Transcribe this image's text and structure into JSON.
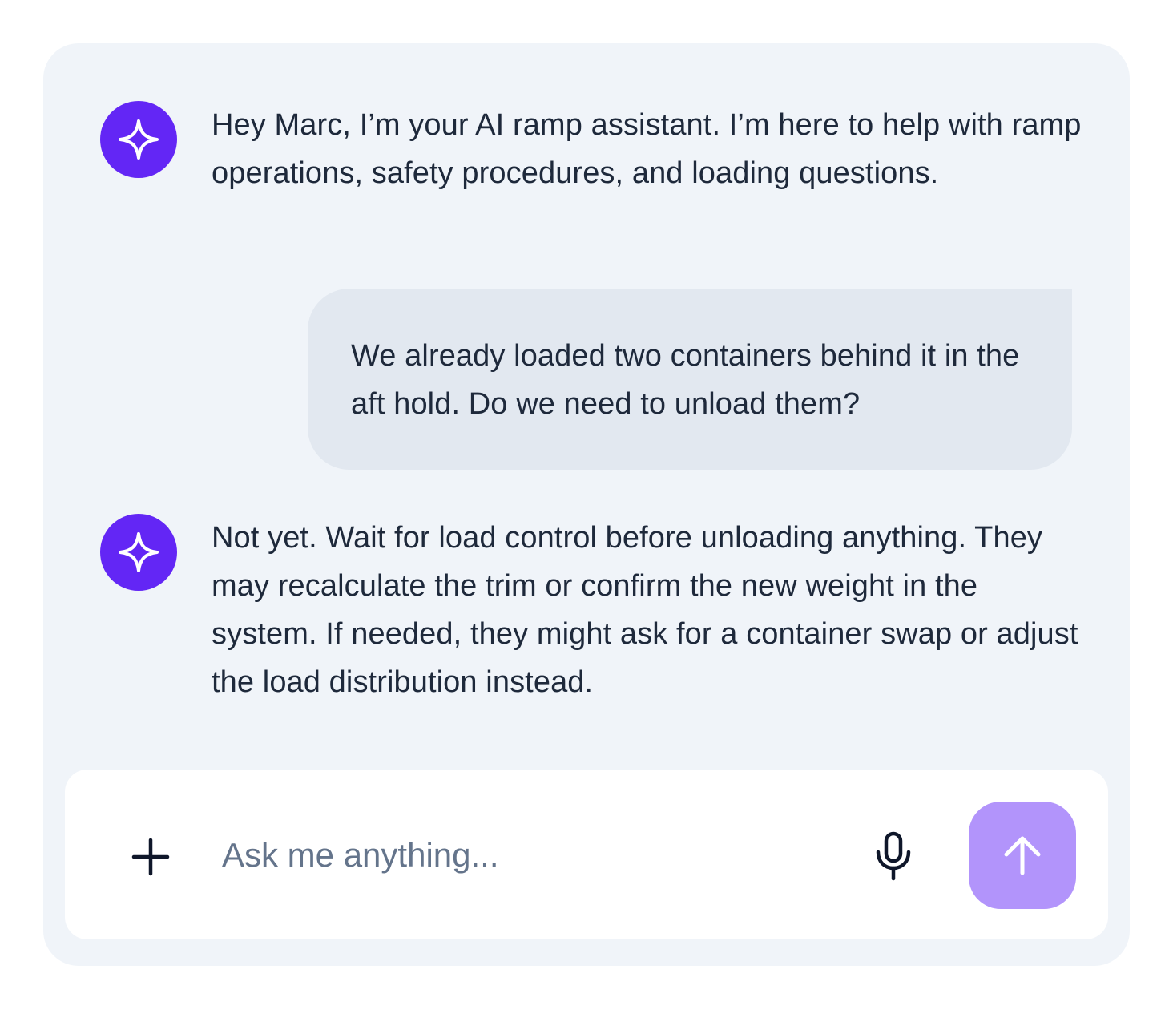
{
  "chat": {
    "messages": [
      {
        "role": "assistant",
        "icon": "sparkle-icon",
        "text": "Hey Marc, I’m your AI ramp assistant. I’m here to help with ramp operations, safety procedures, and loading questions."
      },
      {
        "role": "user",
        "text": "We already loaded two containers behind it in the aft hold. Do we need to unload them?"
      },
      {
        "role": "assistant",
        "icon": "sparkle-icon",
        "text": "Not yet. Wait for load control before unloading anything. They may recalculate the trim or confirm the new weight in the system. If needed, they might ask for a container swap or adjust the load distribution instead."
      }
    ]
  },
  "composer": {
    "placeholder": "Ask me anything...",
    "value": "",
    "attach_icon": "plus-icon",
    "voice_icon": "microphone-icon",
    "send_icon": "arrow-up-icon"
  },
  "colors": {
    "panel_bg": "#f0f4f9",
    "assistant_avatar": "#6326f5",
    "user_bubble": "#e2e8f0",
    "send_button": "#b294fb",
    "text": "#1e293b",
    "placeholder": "#64748b"
  }
}
